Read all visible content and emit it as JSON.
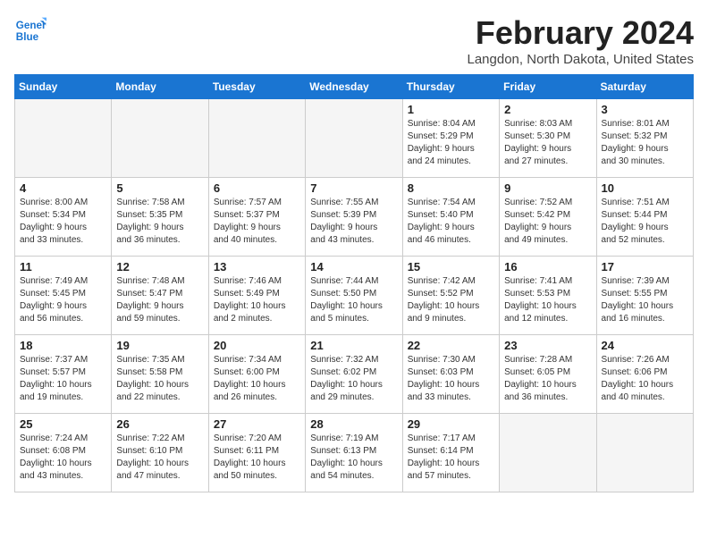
{
  "header": {
    "logo_line1": "General",
    "logo_line2": "Blue",
    "month_year": "February 2024",
    "location": "Langdon, North Dakota, United States"
  },
  "weekdays": [
    "Sunday",
    "Monday",
    "Tuesday",
    "Wednesday",
    "Thursday",
    "Friday",
    "Saturday"
  ],
  "weeks": [
    [
      {
        "day": "",
        "empty": true
      },
      {
        "day": "",
        "empty": true
      },
      {
        "day": "",
        "empty": true
      },
      {
        "day": "",
        "empty": true
      },
      {
        "day": "1",
        "line1": "Sunrise: 8:04 AM",
        "line2": "Sunset: 5:29 PM",
        "line3": "Daylight: 9 hours",
        "line4": "and 24 minutes."
      },
      {
        "day": "2",
        "line1": "Sunrise: 8:03 AM",
        "line2": "Sunset: 5:30 PM",
        "line3": "Daylight: 9 hours",
        "line4": "and 27 minutes."
      },
      {
        "day": "3",
        "line1": "Sunrise: 8:01 AM",
        "line2": "Sunset: 5:32 PM",
        "line3": "Daylight: 9 hours",
        "line4": "and 30 minutes."
      }
    ],
    [
      {
        "day": "4",
        "line1": "Sunrise: 8:00 AM",
        "line2": "Sunset: 5:34 PM",
        "line3": "Daylight: 9 hours",
        "line4": "and 33 minutes."
      },
      {
        "day": "5",
        "line1": "Sunrise: 7:58 AM",
        "line2": "Sunset: 5:35 PM",
        "line3": "Daylight: 9 hours",
        "line4": "and 36 minutes."
      },
      {
        "day": "6",
        "line1": "Sunrise: 7:57 AM",
        "line2": "Sunset: 5:37 PM",
        "line3": "Daylight: 9 hours",
        "line4": "and 40 minutes."
      },
      {
        "day": "7",
        "line1": "Sunrise: 7:55 AM",
        "line2": "Sunset: 5:39 PM",
        "line3": "Daylight: 9 hours",
        "line4": "and 43 minutes."
      },
      {
        "day": "8",
        "line1": "Sunrise: 7:54 AM",
        "line2": "Sunset: 5:40 PM",
        "line3": "Daylight: 9 hours",
        "line4": "and 46 minutes."
      },
      {
        "day": "9",
        "line1": "Sunrise: 7:52 AM",
        "line2": "Sunset: 5:42 PM",
        "line3": "Daylight: 9 hours",
        "line4": "and 49 minutes."
      },
      {
        "day": "10",
        "line1": "Sunrise: 7:51 AM",
        "line2": "Sunset: 5:44 PM",
        "line3": "Daylight: 9 hours",
        "line4": "and 52 minutes."
      }
    ],
    [
      {
        "day": "11",
        "line1": "Sunrise: 7:49 AM",
        "line2": "Sunset: 5:45 PM",
        "line3": "Daylight: 9 hours",
        "line4": "and 56 minutes."
      },
      {
        "day": "12",
        "line1": "Sunrise: 7:48 AM",
        "line2": "Sunset: 5:47 PM",
        "line3": "Daylight: 9 hours",
        "line4": "and 59 minutes."
      },
      {
        "day": "13",
        "line1": "Sunrise: 7:46 AM",
        "line2": "Sunset: 5:49 PM",
        "line3": "Daylight: 10 hours",
        "line4": "and 2 minutes."
      },
      {
        "day": "14",
        "line1": "Sunrise: 7:44 AM",
        "line2": "Sunset: 5:50 PM",
        "line3": "Daylight: 10 hours",
        "line4": "and 5 minutes."
      },
      {
        "day": "15",
        "line1": "Sunrise: 7:42 AM",
        "line2": "Sunset: 5:52 PM",
        "line3": "Daylight: 10 hours",
        "line4": "and 9 minutes."
      },
      {
        "day": "16",
        "line1": "Sunrise: 7:41 AM",
        "line2": "Sunset: 5:53 PM",
        "line3": "Daylight: 10 hours",
        "line4": "and 12 minutes."
      },
      {
        "day": "17",
        "line1": "Sunrise: 7:39 AM",
        "line2": "Sunset: 5:55 PM",
        "line3": "Daylight: 10 hours",
        "line4": "and 16 minutes."
      }
    ],
    [
      {
        "day": "18",
        "line1": "Sunrise: 7:37 AM",
        "line2": "Sunset: 5:57 PM",
        "line3": "Daylight: 10 hours",
        "line4": "and 19 minutes."
      },
      {
        "day": "19",
        "line1": "Sunrise: 7:35 AM",
        "line2": "Sunset: 5:58 PM",
        "line3": "Daylight: 10 hours",
        "line4": "and 22 minutes."
      },
      {
        "day": "20",
        "line1": "Sunrise: 7:34 AM",
        "line2": "Sunset: 6:00 PM",
        "line3": "Daylight: 10 hours",
        "line4": "and 26 minutes."
      },
      {
        "day": "21",
        "line1": "Sunrise: 7:32 AM",
        "line2": "Sunset: 6:02 PM",
        "line3": "Daylight: 10 hours",
        "line4": "and 29 minutes."
      },
      {
        "day": "22",
        "line1": "Sunrise: 7:30 AM",
        "line2": "Sunset: 6:03 PM",
        "line3": "Daylight: 10 hours",
        "line4": "and 33 minutes."
      },
      {
        "day": "23",
        "line1": "Sunrise: 7:28 AM",
        "line2": "Sunset: 6:05 PM",
        "line3": "Daylight: 10 hours",
        "line4": "and 36 minutes."
      },
      {
        "day": "24",
        "line1": "Sunrise: 7:26 AM",
        "line2": "Sunset: 6:06 PM",
        "line3": "Daylight: 10 hours",
        "line4": "and 40 minutes."
      }
    ],
    [
      {
        "day": "25",
        "line1": "Sunrise: 7:24 AM",
        "line2": "Sunset: 6:08 PM",
        "line3": "Daylight: 10 hours",
        "line4": "and 43 minutes."
      },
      {
        "day": "26",
        "line1": "Sunrise: 7:22 AM",
        "line2": "Sunset: 6:10 PM",
        "line3": "Daylight: 10 hours",
        "line4": "and 47 minutes."
      },
      {
        "day": "27",
        "line1": "Sunrise: 7:20 AM",
        "line2": "Sunset: 6:11 PM",
        "line3": "Daylight: 10 hours",
        "line4": "and 50 minutes."
      },
      {
        "day": "28",
        "line1": "Sunrise: 7:19 AM",
        "line2": "Sunset: 6:13 PM",
        "line3": "Daylight: 10 hours",
        "line4": "and 54 minutes."
      },
      {
        "day": "29",
        "line1": "Sunrise: 7:17 AM",
        "line2": "Sunset: 6:14 PM",
        "line3": "Daylight: 10 hours",
        "line4": "and 57 minutes."
      },
      {
        "day": "",
        "empty": true
      },
      {
        "day": "",
        "empty": true
      }
    ]
  ]
}
